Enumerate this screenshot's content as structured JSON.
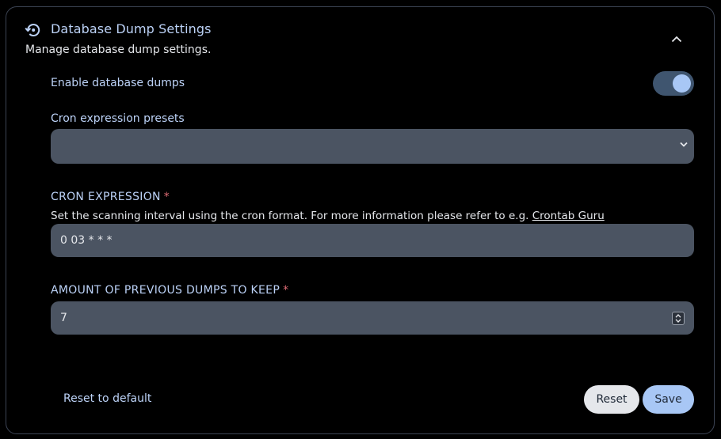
{
  "header": {
    "title": "Database Dump Settings",
    "description": "Manage database dump settings.",
    "icon": "backup-restore-icon"
  },
  "enable": {
    "label": "Enable database dumps",
    "enabled": true
  },
  "presets": {
    "label": "Cron expression presets",
    "value": ""
  },
  "cron": {
    "label": "CRON EXPRESSION",
    "required_mark": "*",
    "help_text": "Set the scanning interval using the cron format. For more information please refer to e.g. ",
    "help_link": "Crontab Guru",
    "value": "0 03 * * *"
  },
  "keep": {
    "label": "AMOUNT OF PREVIOUS DUMPS TO KEEP",
    "required_mark": "*",
    "value": "7"
  },
  "footer": {
    "reset_default_label": "Reset to default",
    "reset_label": "Reset",
    "save_label": "Save"
  },
  "colors": {
    "background": "#000000",
    "accent": "#a8c7f5",
    "field_bg": "#4b5462",
    "required": "#e06c75"
  }
}
